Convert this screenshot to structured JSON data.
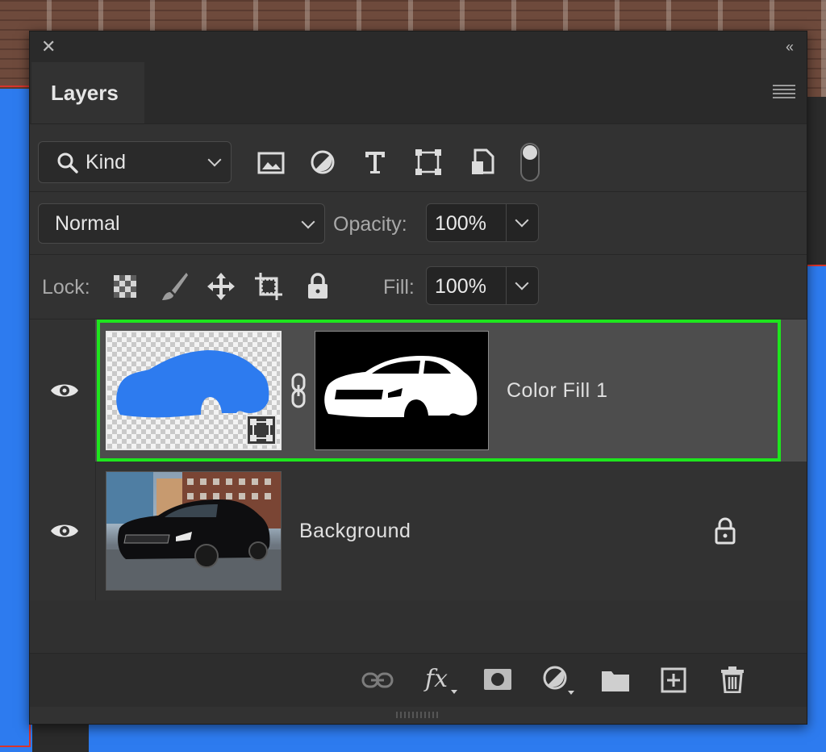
{
  "panel": {
    "close_glyph": "✕",
    "collapse_glyph": "‹‹",
    "tab_label": "Layers"
  },
  "filter": {
    "kind_label": "Kind",
    "icons": [
      "image-filter-icon",
      "adjustment-filter-icon",
      "type-filter-icon",
      "shape-filter-icon",
      "smart-object-filter-icon",
      "filter-toggle-switch"
    ]
  },
  "blend": {
    "mode": "Normal",
    "opacity_label": "Opacity:",
    "opacity_value": "100%"
  },
  "lock": {
    "label": "Lock:",
    "fill_label": "Fill:",
    "fill_value": "100%"
  },
  "layers": [
    {
      "name": "Color Fill 1",
      "visible": true,
      "selected": true,
      "fill_color": "#2d7bef"
    },
    {
      "name": "Background",
      "visible": true,
      "locked": true
    }
  ],
  "colors": {
    "panel_bg": "#323232",
    "selection_outline": "#1ee51e",
    "fill_blue": "#2d7bef"
  }
}
